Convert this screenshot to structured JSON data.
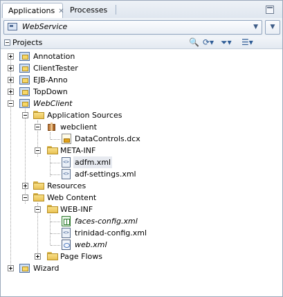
{
  "tabs": [
    {
      "label": "Applications",
      "close": "✕"
    },
    {
      "label": "Processes"
    }
  ],
  "app_selector": {
    "value": "WebService"
  },
  "projects_panel": {
    "title": "Projects"
  },
  "tree": [
    {
      "label": "Annotation"
    },
    {
      "label": "ClientTester"
    },
    {
      "label": "EJB-Anno"
    },
    {
      "label": "TopDown"
    },
    {
      "label": "WebClient"
    },
    {
      "label": "Application Sources"
    },
    {
      "label": "webclient"
    },
    {
      "label": "DataControls.dcx"
    },
    {
      "label": "META-INF"
    },
    {
      "label": "adfm.xml"
    },
    {
      "label": "adf-settings.xml"
    },
    {
      "label": "Resources"
    },
    {
      "label": "Web Content"
    },
    {
      "label": "WEB-INF"
    },
    {
      "label": "faces-config.xml"
    },
    {
      "label": "trinidad-config.xml"
    },
    {
      "label": "web.xml"
    },
    {
      "label": "Page Flows"
    },
    {
      "label": "Wizard"
    }
  ]
}
